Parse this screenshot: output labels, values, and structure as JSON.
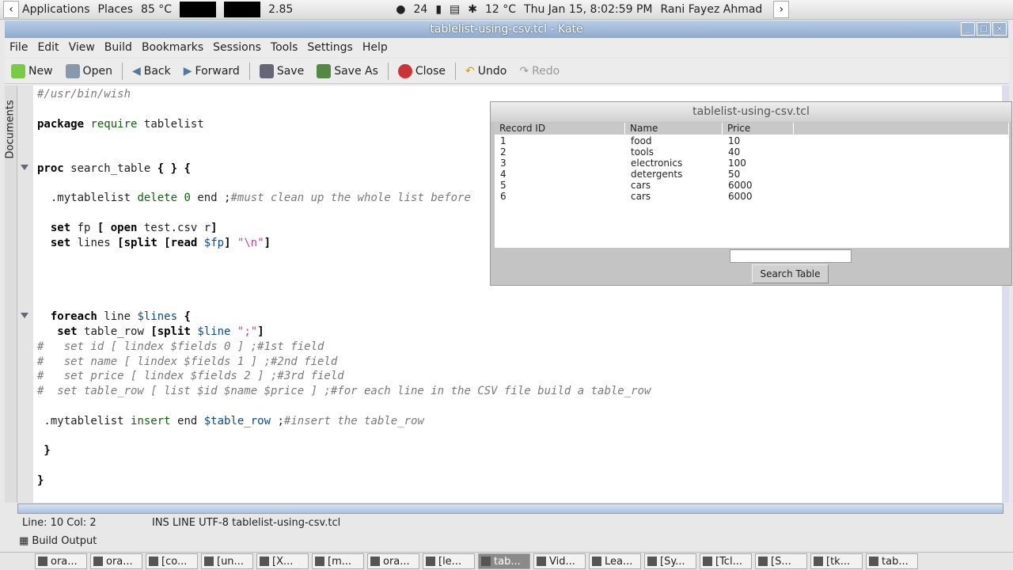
{
  "panel": {
    "applications": "Applications",
    "places": "Places",
    "temp": "85 °C",
    "load": "2.85",
    "weather": "12 °C",
    "datetime": "Thu Jan 15,  8:02:59 PM",
    "user": "Rani Fayez Ahmad",
    "calendar_day": "24"
  },
  "window": {
    "title": "tablelist-using-csv.tcl - Kate"
  },
  "menu": [
    "File",
    "Edit",
    "View",
    "Build",
    "Bookmarks",
    "Sessions",
    "Tools",
    "Settings",
    "Help"
  ],
  "toolbar": {
    "new": "New",
    "open": "Open",
    "back": "Back",
    "forward": "Forward",
    "save": "Save",
    "save_as": "Save As",
    "close": "Close",
    "undo": "Undo",
    "redo": "Redo"
  },
  "sidebar": {
    "documents": "Documents"
  },
  "code": [
    [
      [
        "#/usr/bin/wish",
        "cm"
      ]
    ],
    [],
    [
      [
        "package",
        "kw"
      ],
      [
        " ",
        "n"
      ],
      [
        "require",
        "gr"
      ],
      [
        " tablelist",
        "n"
      ]
    ],
    [],
    [],
    [
      [
        "proc",
        "kw"
      ],
      [
        " search_table ",
        "n"
      ],
      [
        "{ } {",
        "kw"
      ]
    ],
    [],
    [
      [
        "  .mytablelist ",
        "n"
      ],
      [
        "delete",
        "gr"
      ],
      [
        " ",
        "n"
      ],
      [
        "0",
        "gr"
      ],
      [
        " end ;",
        "n"
      ],
      [
        "#must clean up the whole list before",
        "cm"
      ]
    ],
    [],
    [
      [
        "  ",
        "n"
      ],
      [
        "set",
        "kw"
      ],
      [
        " fp ",
        "n"
      ],
      [
        "[ open",
        "kw"
      ],
      [
        " test.csv r",
        "n"
      ],
      [
        "]",
        "kw"
      ]
    ],
    [
      [
        "  ",
        "n"
      ],
      [
        "set",
        "kw"
      ],
      [
        " lines ",
        "n"
      ],
      [
        "[split [read",
        "kw"
      ],
      [
        " ",
        "n"
      ],
      [
        "$fp",
        "va"
      ],
      [
        "]",
        "kw"
      ],
      [
        " ",
        "n"
      ],
      [
        "\"\\n\"",
        "st"
      ],
      [
        "]",
        "kw"
      ]
    ],
    [],
    [],
    [],
    [],
    [
      [
        "  ",
        "n"
      ],
      [
        "foreach",
        "kw"
      ],
      [
        " line ",
        "n"
      ],
      [
        "$lines",
        "va"
      ],
      [
        " {",
        "kw"
      ]
    ],
    [
      [
        "   ",
        "n"
      ],
      [
        "set",
        "kw"
      ],
      [
        " table_row ",
        "n"
      ],
      [
        "[split",
        "kw"
      ],
      [
        " ",
        "n"
      ],
      [
        "$line",
        "va"
      ],
      [
        " \";\"",
        "st"
      ],
      [
        "]",
        "kw"
      ]
    ],
    [
      [
        "#   set id [ lindex $fields 0 ] ;#1st field",
        "cm"
      ]
    ],
    [
      [
        "#   set name [ lindex $fields 1 ] ;#2nd field",
        "cm"
      ]
    ],
    [
      [
        "#   set price [ lindex $fields 2 ] ;#3rd field",
        "cm"
      ]
    ],
    [
      [
        "#  set table_row [ list $id $name $price ] ;#for each line in the CSV file build a table_row",
        "cm"
      ]
    ],
    [],
    [
      [
        " .mytablelist ",
        "n"
      ],
      [
        "insert",
        "gr"
      ],
      [
        " end ",
        "n"
      ],
      [
        "$table_row",
        "va"
      ],
      [
        " ;",
        "n"
      ],
      [
        "#insert the table_row",
        "cm"
      ]
    ],
    [],
    [
      [
        " }",
        "kw"
      ]
    ],
    [],
    [
      [
        "}",
        "kw"
      ]
    ]
  ],
  "status": {
    "position": "Line: 10 Col: 2",
    "mode": "INS  LINE  UTF-8 tablelist-using-csv.tcl",
    "build_output": "Build Output"
  },
  "taskbar": [
    "ora...",
    "ora...",
    "[co...",
    "[un...",
    "[X...",
    "[m...",
    "ora...",
    "[le...",
    "tab...",
    "Vid...",
    "Lea...",
    "[Sy...",
    "[Tcl...",
    "[S...",
    "[tk...",
    "tab..."
  ],
  "dialog": {
    "title": "tablelist-using-csv.tcl",
    "columns": [
      "Record ID",
      "Name",
      "Price"
    ],
    "rows": [
      [
        "1",
        "food",
        "10"
      ],
      [
        "2",
        "tools",
        "40"
      ],
      [
        "3",
        "electronics",
        "100"
      ],
      [
        "4",
        "detergents",
        "50"
      ],
      [
        "5",
        "cars",
        "6000"
      ],
      [
        "6",
        "cars",
        "6000"
      ]
    ],
    "search_value": "",
    "search_button": "Search Table"
  }
}
